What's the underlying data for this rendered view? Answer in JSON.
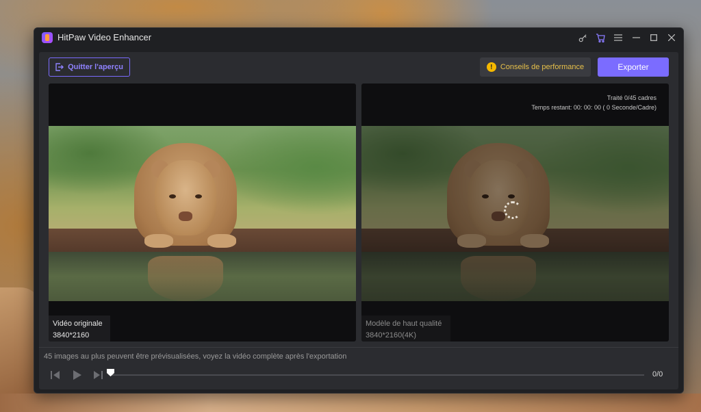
{
  "window": {
    "title": "HitPaw Video Enhancer"
  },
  "titlebar_icons": [
    "key-icon",
    "cart-icon",
    "menu-icon",
    "minimize-icon",
    "maximize-icon",
    "close-icon"
  ],
  "toolbar": {
    "quit_label": "Quitter l'aperçu",
    "tips_label": "Conseils de performance",
    "export_label": "Exporter"
  },
  "original_pane": {
    "label": "Vidéo originale",
    "resolution": "3840*2160"
  },
  "enhanced_pane": {
    "label": "Modèle de haut qualité",
    "resolution": "3840*2160(4K)",
    "processed": "Traité 0/45 cadres",
    "remaining": "Temps restant: 00: 00: 00 ( 0 Seconde/Cadre)"
  },
  "footer": {
    "notice": "45 images au plus peuvent être prévisualisées, voyez la vidéo complète après l'exportation",
    "frame_count": "0/0"
  },
  "colors": {
    "accent": "#7b6cff",
    "warning": "#f5b800",
    "background": "#1f2023"
  }
}
